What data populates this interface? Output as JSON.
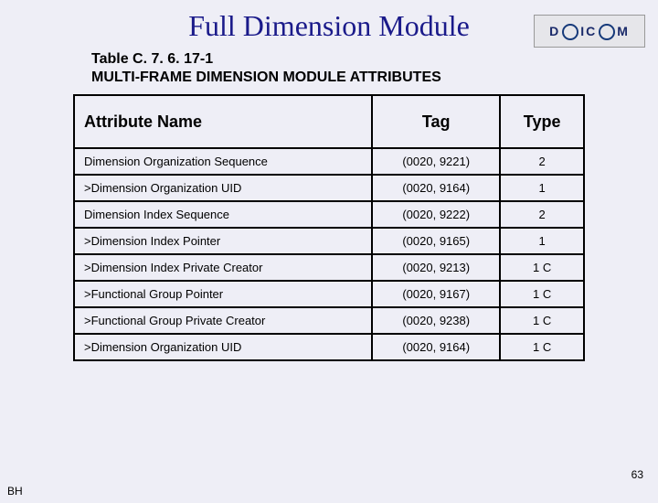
{
  "logo_text": "DICOM",
  "title": "Full Dimension Module",
  "caption_line1": "Table C. 7. 6. 17-1",
  "caption_line2": "MULTI-FRAME DIMENSION MODULE ATTRIBUTES",
  "headers": {
    "attr": "Attribute Name",
    "tag": "Tag",
    "type": "Type"
  },
  "rows": [
    {
      "attr": "Dimension Organization Sequence",
      "tag": "(0020, 9221)",
      "type": "2"
    },
    {
      "attr": ">Dimension Organization UID",
      "tag": "(0020, 9164)",
      "type": "1"
    },
    {
      "attr": "Dimension Index Sequence",
      "tag": "(0020, 9222)",
      "type": "2"
    },
    {
      "attr": ">Dimension Index Pointer",
      "tag": "(0020, 9165)",
      "type": "1"
    },
    {
      "attr": ">Dimension Index Private Creator",
      "tag": "(0020, 9213)",
      "type": "1 C"
    },
    {
      "attr": ">Functional Group Pointer",
      "tag": "(0020, 9167)",
      "type": "1 C"
    },
    {
      "attr": ">Functional Group Private Creator",
      "tag": "(0020, 9238)",
      "type": "1 C"
    },
    {
      "attr": ">Dimension Organization UID",
      "tag": "(0020, 9164)",
      "type": "1 C"
    }
  ],
  "page_number": "63",
  "footer": "BH"
}
